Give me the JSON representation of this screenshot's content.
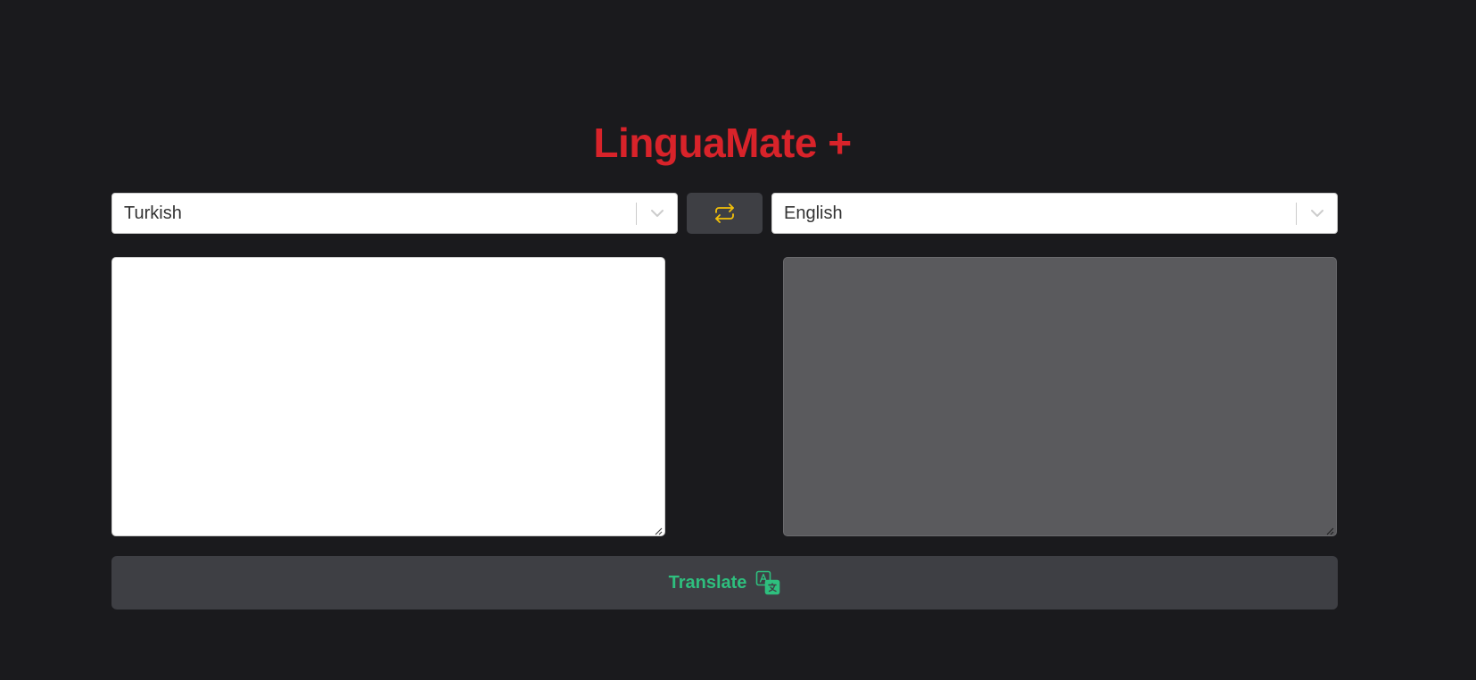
{
  "app": {
    "title": "LinguaMate +"
  },
  "source_language": {
    "selected": "Turkish",
    "placeholder": ""
  },
  "target_language": {
    "selected": "English"
  },
  "swap_button": {
    "icon": "swap-arrows-icon",
    "color": "#f2c00a"
  },
  "source_text": {
    "value": "",
    "placeholder": ""
  },
  "target_text": {
    "value": ""
  },
  "translate_button": {
    "label": "Translate",
    "icon": "translate-icon",
    "color": "#2ebf7e"
  },
  "colors": {
    "background": "#1a1a1d",
    "title": "#d8232a",
    "button_bg": "#3e3f44",
    "output_bg": "#5a5a5d"
  }
}
